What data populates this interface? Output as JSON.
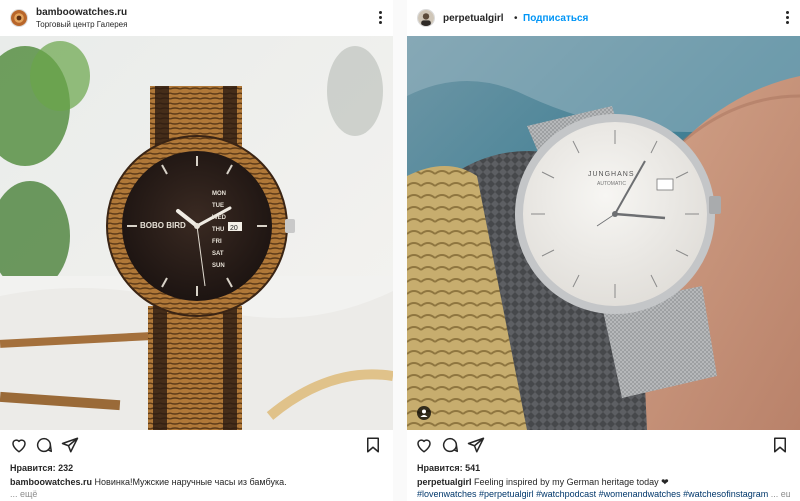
{
  "posts": [
    {
      "username": "bamboowatches.ru",
      "location": "Торговый центр Галерея",
      "likes_label": "Нравится:",
      "likes_count": "232",
      "caption_text": "Новинка!Мужские наручные часы из бамбука.",
      "more_label": "... ещё",
      "watch_brand": "BOBO BIRD",
      "watch_days": [
        "MON",
        "TUE",
        "WED",
        "THU",
        "FRI",
        "SAT",
        "SUN"
      ],
      "watch_date": "20"
    },
    {
      "username": "perpetualgirl",
      "follow_label": "Подписаться",
      "separator": "•",
      "likes_label": "Нравится:",
      "likes_count": "541",
      "caption_text": "Feeling inspired by my German heritage today ❤",
      "hashtags": "#lovenwatches #perpetualgirl #watchpodcast #womenandwatches #watchesofinstagram",
      "more_label": "... ещё",
      "watch_brand": "JUNGHANS",
      "watch_subtitle": "AUTOMATIC"
    }
  ],
  "icons": [
    "more-icon",
    "heart-icon",
    "comment-icon",
    "share-icon",
    "bookmark-icon",
    "user-tag-icon"
  ],
  "colors": {
    "link_blue": "#0095f6",
    "hashtag": "#00376b",
    "muted": "#8e8e8e",
    "text": "#262626"
  }
}
